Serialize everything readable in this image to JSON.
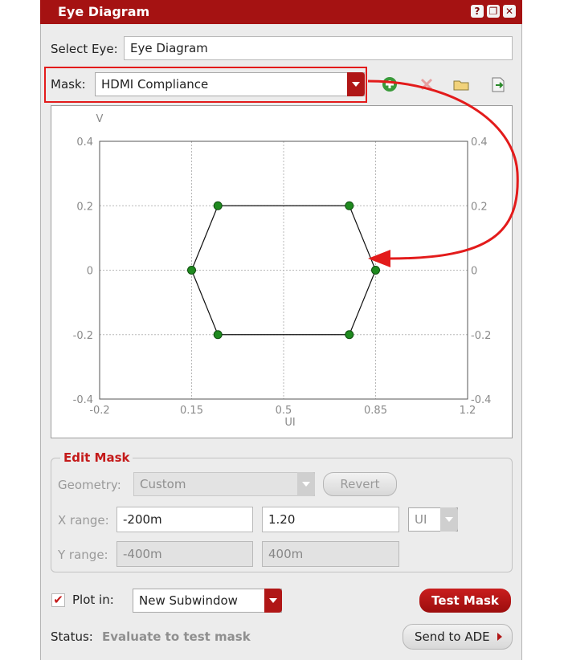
{
  "window": {
    "title": "Eye Diagram",
    "buttons": [
      {
        "name": "help-icon",
        "glyph": "?"
      },
      {
        "name": "float-icon",
        "glyph": "❐"
      },
      {
        "name": "close-icon",
        "glyph": "✕"
      }
    ]
  },
  "select_eye": {
    "label": "Select Eye:",
    "value": "Eye Diagram"
  },
  "mask": {
    "label": "Mask:",
    "value": "HDMI Compliance",
    "tools": [
      {
        "name": "add-mask-icon",
        "glyph": "⊕"
      },
      {
        "name": "delete-mask-icon",
        "glyph": "✕"
      },
      {
        "name": "open-folder-icon",
        "glyph": "📂"
      },
      {
        "name": "export-icon",
        "glyph": "⇥"
      }
    ]
  },
  "chart_data": {
    "type": "scatter",
    "xlabel": "UI",
    "ylabel": "V",
    "xlim": [
      -0.2,
      1.2
    ],
    "ylim": [
      -0.4,
      0.4
    ],
    "x_ticks": [
      "-0.2",
      "0.15",
      "0.5",
      "0.85",
      "1.2"
    ],
    "x_tick_values": [
      -0.2,
      0.15,
      0.5,
      0.85,
      1.2
    ],
    "y_ticks": [
      "0.4",
      "0.2",
      "0",
      "-0.2",
      "-0.4"
    ],
    "y_tick_values": [
      0.4,
      0.2,
      0,
      -0.2,
      -0.4
    ],
    "grid": true,
    "mask_polygon": [
      {
        "x": 0.15,
        "y": 0
      },
      {
        "x": 0.25,
        "y": 0.2
      },
      {
        "x": 0.75,
        "y": 0.2
      },
      {
        "x": 0.85,
        "y": 0
      },
      {
        "x": 0.75,
        "y": -0.2
      },
      {
        "x": 0.25,
        "y": -0.2
      }
    ],
    "point_color": "#1f8a1f",
    "line_color": "#111111"
  },
  "edit_mask": {
    "title": "Edit Mask",
    "geometry": {
      "label": "Geometry:",
      "value": "Custom"
    },
    "revert_label": "Revert",
    "x_range": {
      "label": "X range:",
      "min": "-200m",
      "max": "1.20",
      "unit": "UI"
    },
    "y_range": {
      "label": "Y range:",
      "min": "-400m",
      "max": "400m"
    }
  },
  "plot_in": {
    "label": "Plot in:",
    "checked": true,
    "value": "New Subwindow"
  },
  "test_mask_label": "Test Mask",
  "status": {
    "label": "Status:",
    "value": "Evaluate to test mask"
  },
  "send_to_ade_label": "Send to ADE",
  "colors": {
    "accent": "#a51212",
    "annotation": "#e31b1b"
  }
}
